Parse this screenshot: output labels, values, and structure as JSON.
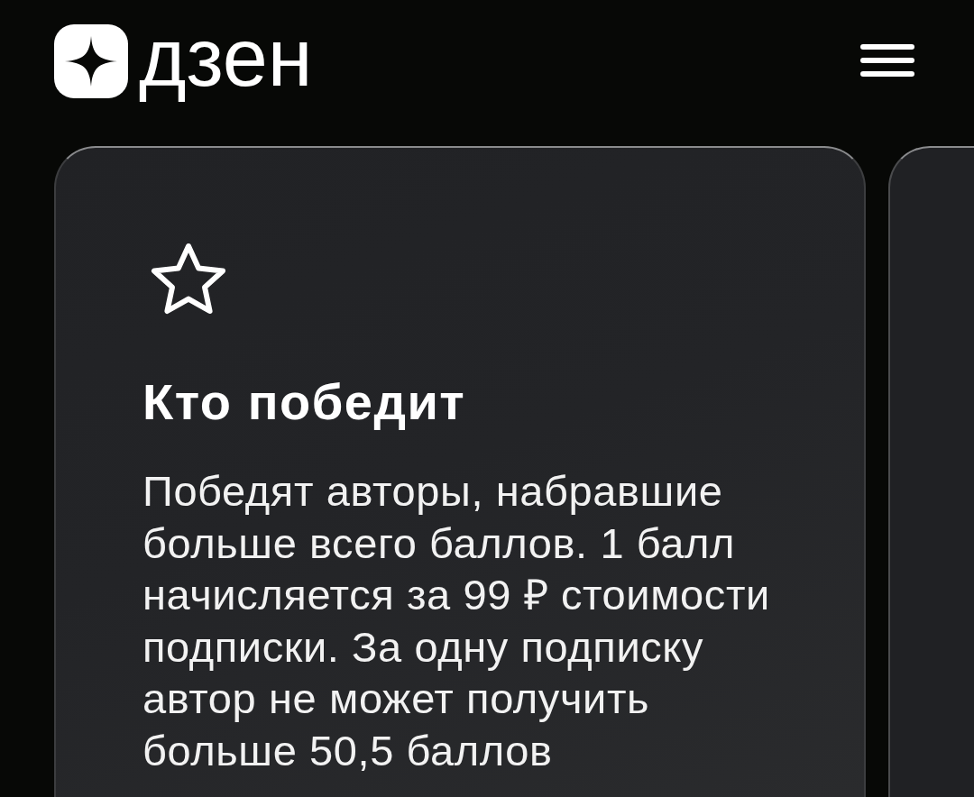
{
  "header": {
    "logo_text": "дзен"
  },
  "cards": [
    {
      "kind": "info",
      "title": "Кто победит",
      "text": "Победят авторы, набравшие\nбольше всего баллов. 1 балл\nначисляется за 99 ₽ стоимости\nподписки. За одну подписку\nавтор не может получить\nбольше 50,5 баллов"
    },
    {
      "kind": "cut_off"
    }
  ]
}
